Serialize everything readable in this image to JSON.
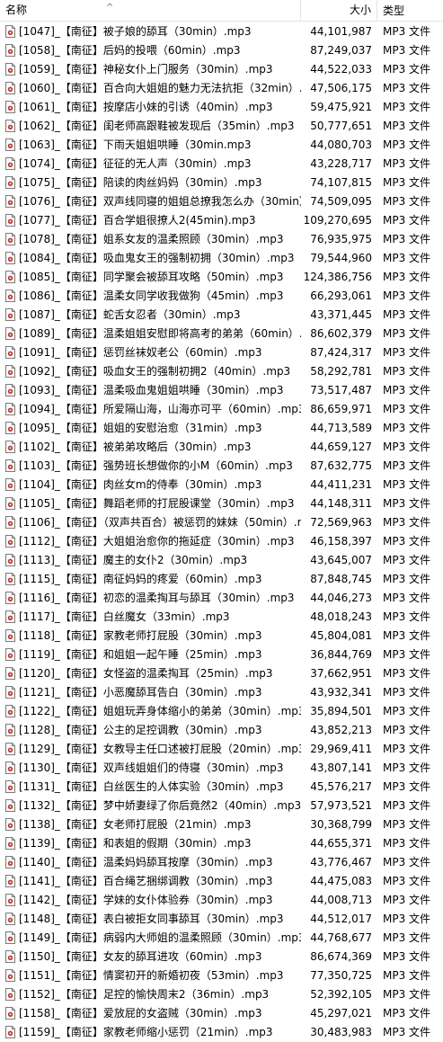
{
  "header": {
    "name": "名称",
    "size": "大小",
    "type": "类型",
    "sort_arrow": "^"
  },
  "file_type": "MP3 文件",
  "files": [
    {
      "name": "[1047]_【南征】被子娘的舔耳（30min）.mp3",
      "size": "44,101,987"
    },
    {
      "name": "[1058]_【南征】后妈的投喂（60min）.mp3",
      "size": "87,249,037"
    },
    {
      "name": "[1059]_【南征】神秘女仆上门服务（30min）.mp3",
      "size": "44,522,033"
    },
    {
      "name": "[1060]_【南征】百合向大姐姐的魅力无法抗拒（32min）.mp3",
      "size": "47,506,175"
    },
    {
      "name": "[1061]_【南征】按摩店小妹的引诱（40min）.mp3",
      "size": "59,475,921"
    },
    {
      "name": "[1062]_【南征】闺老师高跟鞋被发现后（35min）.mp3",
      "size": "50,777,651"
    },
    {
      "name": "[1063]_【南征】下雨天姐姐哄睡（30min.mp3",
      "size": "44,080,703"
    },
    {
      "name": "[1074]_【南征】征征的无人声（30min）.mp3",
      "size": "43,228,717"
    },
    {
      "name": "[1075]_【南征】陪读的肉丝妈妈（30min）.mp3",
      "size": "74,107,815"
    },
    {
      "name": "[1076]_【南征】双声线同寝的姐姐总撩我怎么办（30min）.mp3",
      "size": "74,509,095"
    },
    {
      "name": "[1077]_【南征】百合学姐很撩人2(45min).mp3",
      "size": "109,270,695"
    },
    {
      "name": "[1078]_【南征】姐系女友的温柔照顾（30min）.mp3",
      "size": "76,935,975"
    },
    {
      "name": "[1084]_【南征】吸血鬼女王的强制初拥（30min）.mp3",
      "size": "79,544,960"
    },
    {
      "name": "[1085]_【南征】同学聚会被舔耳攻略（50min）.mp3",
      "size": "124,386,756"
    },
    {
      "name": "[1086]_【南征】温柔女同学收我做狗（45min）.mp3",
      "size": "66,293,061"
    },
    {
      "name": "[1087]_【南征】蛇舌女忍者（30min）.mp3",
      "size": "43,371,445"
    },
    {
      "name": "[1089]_【南征】温柔姐姐安慰即将高考的弟弟（60min）.mp3",
      "size": "86,602,379"
    },
    {
      "name": "[1091]_【南征】惩罚丝袜奴老公（60min）.mp3",
      "size": "87,424,317"
    },
    {
      "name": "[1092]_【南征】吸血女王的强制初拥2（40min）.mp3",
      "size": "58,292,781"
    },
    {
      "name": "[1093]_【南征】温柔吸血鬼姐姐哄睡（30min）.mp3",
      "size": "73,517,487"
    },
    {
      "name": "[1094]_【南征】所爱隔山海，山海亦可平（60min）.mp3",
      "size": "86,659,971"
    },
    {
      "name": "[1095]_【南征】姐姐的安慰治愈（31min）.mp3",
      "size": "44,713,589"
    },
    {
      "name": "[1102]_【南征】被弟弟攻略后（30min）.mp3",
      "size": "44,659,127"
    },
    {
      "name": "[1103]_【南征】强势班长想做你的小M（60min）.mp3",
      "size": "87,632,775"
    },
    {
      "name": "[1104]_【南征】肉丝女m的侍奉（30min）.mp3",
      "size": "44,411,231"
    },
    {
      "name": "[1105]_【南征】舞蹈老师的打屁股课堂（30min）.mp3",
      "size": "44,148,311"
    },
    {
      "name": "[1106]_【南征】（双声共百合）被惩罚的妹妹（50min）.mp3",
      "size": "72,569,963"
    },
    {
      "name": "[1112]_【南征】大姐姐治愈你的拖延症（30min）.mp3",
      "size": "46,158,397"
    },
    {
      "name": "[1113]_【南征】魔主的女仆2（30min）.mp3",
      "size": "43,645,007"
    },
    {
      "name": "[1115]_【南征】南征妈妈的疼爱（60min）.mp3",
      "size": "87,848,745"
    },
    {
      "name": "[1116]_【南征】初恋的温柔掏耳与舔耳（30min）.mp3",
      "size": "44,046,273"
    },
    {
      "name": "[1117]_【南征】白丝魔女（33min）.mp3",
      "size": "48,018,243"
    },
    {
      "name": "[1118]_【南征】家教老师打屁股（30min）.mp3",
      "size": "45,804,081"
    },
    {
      "name": "[1119]_【南征】和姐姐一起午睡（25min）.mp3",
      "size": "36,844,769"
    },
    {
      "name": "[1120]_【南征】女怪盗的温柔掏耳（25min）.mp3",
      "size": "37,662,951"
    },
    {
      "name": "[1121]_【南征】小恶魔舔耳告白（30min）.mp3",
      "size": "43,932,341"
    },
    {
      "name": "[1122]_【南征】姐姐玩弄身体缩小的弟弟（30min）.mp3",
      "size": "35,894,501"
    },
    {
      "name": "[1128]_【南征】公主的足控调教（30min）.mp3",
      "size": "43,852,213"
    },
    {
      "name": "[1129]_【南征】女教导主任口述被打屁股（20min）.mp3",
      "size": "29,969,411"
    },
    {
      "name": "[1130]_【南征】双声线姐姐们的侍寝（30min）.mp3",
      "size": "43,807,141"
    },
    {
      "name": "[1131]_【南征】白丝医生的人体实验（30min）.mp3",
      "size": "45,576,217"
    },
    {
      "name": "[1132]_【南征】梦中娇妻绿了你后竟然2（40min）.mp3",
      "size": "57,973,521"
    },
    {
      "name": "[1138]_【南征】女老师打屁股（21min）.mp3",
      "size": "30,368,799"
    },
    {
      "name": "[1139]_【南征】和表姐的假期（30min）.mp3",
      "size": "44,655,371"
    },
    {
      "name": "[1140]_【南征】温柔妈妈舔耳按摩（30min）.mp3",
      "size": "43,776,467"
    },
    {
      "name": "[1141]_【南征】百合绳艺捆绑调教（30min）.mp3",
      "size": "44,475,083"
    },
    {
      "name": "[1142]_【南征】学妹的女仆体验券（30min）.mp3",
      "size": "44,008,713"
    },
    {
      "name": "[1148]_【南征】表白被拒女同事舔耳（30min）.mp3",
      "size": "44,512,017"
    },
    {
      "name": "[1149]_【南征】病弱内大师姐的温柔照顾（30min）.mp3",
      "size": "44,768,677"
    },
    {
      "name": "[1150]_【南征】女友的舔耳进攻（60min）.mp3",
      "size": "86,674,369"
    },
    {
      "name": "[1151]_【南征】情窦初开的新婚初夜（53min）.mp3",
      "size": "77,350,725"
    },
    {
      "name": "[1152]_【南征】足控的愉快周末2（36min）.mp3",
      "size": "52,392,105"
    },
    {
      "name": "[1158]_【南征】爱放屁的女盗贼（30min）.mp3",
      "size": "45,297,021"
    },
    {
      "name": "[1159]_【南征】家教老师缩小惩罚（21min）.mp3",
      "size": "30,483,983"
    }
  ]
}
